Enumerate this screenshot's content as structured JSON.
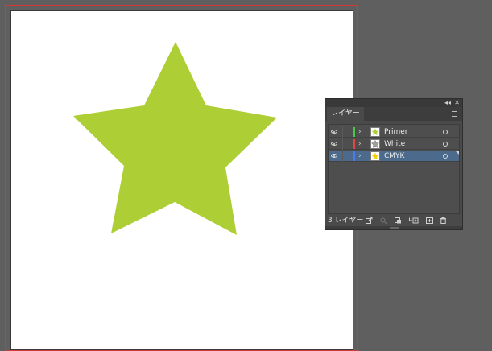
{
  "canvas": {
    "star_color": "#aece35",
    "bleed_color": "#d23a3a"
  },
  "layers_panel": {
    "collapse_label": "◂◂",
    "close_label": "✕",
    "tab_label": "レイヤー",
    "menu_icon": "hamburger-menu-icon",
    "layer_count": "3 レイヤー",
    "layers": [
      {
        "name": "Primer",
        "color": "#48c848",
        "thumb_fill": "#aece35",
        "selected": false
      },
      {
        "name": "White",
        "color": "#e04848",
        "thumb_fill": "#a0a0a0",
        "selected": false
      },
      {
        "name": "CMYK",
        "color": "#4a7cf0",
        "thumb_fill": "#f0d000",
        "selected": true
      }
    ],
    "footer_icons": [
      "export-icon",
      "locate-object-icon",
      "clipping-mask-icon",
      "create-sublayer-icon",
      "new-layer-icon",
      "delete-icon"
    ]
  }
}
